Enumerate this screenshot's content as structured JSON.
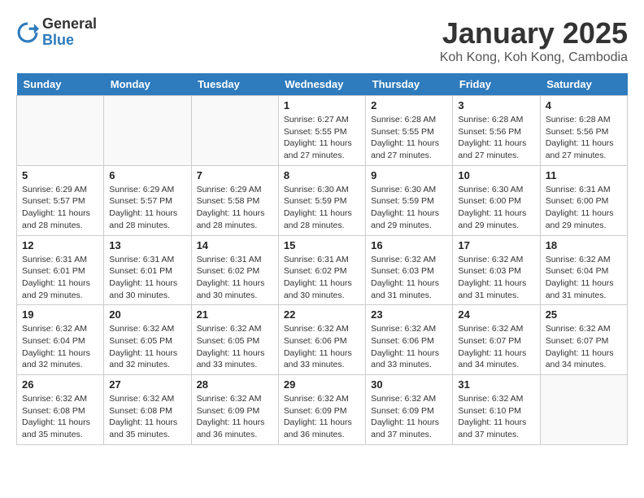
{
  "header": {
    "logo_general": "General",
    "logo_blue": "Blue",
    "title": "January 2025",
    "location": "Koh Kong, Koh Kong, Cambodia"
  },
  "weekdays": [
    "Sunday",
    "Monday",
    "Tuesday",
    "Wednesday",
    "Thursday",
    "Friday",
    "Saturday"
  ],
  "weeks": [
    [
      {
        "day": "",
        "info": ""
      },
      {
        "day": "",
        "info": ""
      },
      {
        "day": "",
        "info": ""
      },
      {
        "day": "1",
        "info": "Sunrise: 6:27 AM\nSunset: 5:55 PM\nDaylight: 11 hours and 27 minutes."
      },
      {
        "day": "2",
        "info": "Sunrise: 6:28 AM\nSunset: 5:55 PM\nDaylight: 11 hours and 27 minutes."
      },
      {
        "day": "3",
        "info": "Sunrise: 6:28 AM\nSunset: 5:56 PM\nDaylight: 11 hours and 27 minutes."
      },
      {
        "day": "4",
        "info": "Sunrise: 6:28 AM\nSunset: 5:56 PM\nDaylight: 11 hours and 27 minutes."
      }
    ],
    [
      {
        "day": "5",
        "info": "Sunrise: 6:29 AM\nSunset: 5:57 PM\nDaylight: 11 hours and 28 minutes."
      },
      {
        "day": "6",
        "info": "Sunrise: 6:29 AM\nSunset: 5:57 PM\nDaylight: 11 hours and 28 minutes."
      },
      {
        "day": "7",
        "info": "Sunrise: 6:29 AM\nSunset: 5:58 PM\nDaylight: 11 hours and 28 minutes."
      },
      {
        "day": "8",
        "info": "Sunrise: 6:30 AM\nSunset: 5:59 PM\nDaylight: 11 hours and 28 minutes."
      },
      {
        "day": "9",
        "info": "Sunrise: 6:30 AM\nSunset: 5:59 PM\nDaylight: 11 hours and 29 minutes."
      },
      {
        "day": "10",
        "info": "Sunrise: 6:30 AM\nSunset: 6:00 PM\nDaylight: 11 hours and 29 minutes."
      },
      {
        "day": "11",
        "info": "Sunrise: 6:31 AM\nSunset: 6:00 PM\nDaylight: 11 hours and 29 minutes."
      }
    ],
    [
      {
        "day": "12",
        "info": "Sunrise: 6:31 AM\nSunset: 6:01 PM\nDaylight: 11 hours and 29 minutes."
      },
      {
        "day": "13",
        "info": "Sunrise: 6:31 AM\nSunset: 6:01 PM\nDaylight: 11 hours and 30 minutes."
      },
      {
        "day": "14",
        "info": "Sunrise: 6:31 AM\nSunset: 6:02 PM\nDaylight: 11 hours and 30 minutes."
      },
      {
        "day": "15",
        "info": "Sunrise: 6:31 AM\nSunset: 6:02 PM\nDaylight: 11 hours and 30 minutes."
      },
      {
        "day": "16",
        "info": "Sunrise: 6:32 AM\nSunset: 6:03 PM\nDaylight: 11 hours and 31 minutes."
      },
      {
        "day": "17",
        "info": "Sunrise: 6:32 AM\nSunset: 6:03 PM\nDaylight: 11 hours and 31 minutes."
      },
      {
        "day": "18",
        "info": "Sunrise: 6:32 AM\nSunset: 6:04 PM\nDaylight: 11 hours and 31 minutes."
      }
    ],
    [
      {
        "day": "19",
        "info": "Sunrise: 6:32 AM\nSunset: 6:04 PM\nDaylight: 11 hours and 32 minutes."
      },
      {
        "day": "20",
        "info": "Sunrise: 6:32 AM\nSunset: 6:05 PM\nDaylight: 11 hours and 32 minutes."
      },
      {
        "day": "21",
        "info": "Sunrise: 6:32 AM\nSunset: 6:05 PM\nDaylight: 11 hours and 33 minutes."
      },
      {
        "day": "22",
        "info": "Sunrise: 6:32 AM\nSunset: 6:06 PM\nDaylight: 11 hours and 33 minutes."
      },
      {
        "day": "23",
        "info": "Sunrise: 6:32 AM\nSunset: 6:06 PM\nDaylight: 11 hours and 33 minutes."
      },
      {
        "day": "24",
        "info": "Sunrise: 6:32 AM\nSunset: 6:07 PM\nDaylight: 11 hours and 34 minutes."
      },
      {
        "day": "25",
        "info": "Sunrise: 6:32 AM\nSunset: 6:07 PM\nDaylight: 11 hours and 34 minutes."
      }
    ],
    [
      {
        "day": "26",
        "info": "Sunrise: 6:32 AM\nSunset: 6:08 PM\nDaylight: 11 hours and 35 minutes."
      },
      {
        "day": "27",
        "info": "Sunrise: 6:32 AM\nSunset: 6:08 PM\nDaylight: 11 hours and 35 minutes."
      },
      {
        "day": "28",
        "info": "Sunrise: 6:32 AM\nSunset: 6:09 PM\nDaylight: 11 hours and 36 minutes."
      },
      {
        "day": "29",
        "info": "Sunrise: 6:32 AM\nSunset: 6:09 PM\nDaylight: 11 hours and 36 minutes."
      },
      {
        "day": "30",
        "info": "Sunrise: 6:32 AM\nSunset: 6:09 PM\nDaylight: 11 hours and 37 minutes."
      },
      {
        "day": "31",
        "info": "Sunrise: 6:32 AM\nSunset: 6:10 PM\nDaylight: 11 hours and 37 minutes."
      },
      {
        "day": "",
        "info": ""
      }
    ]
  ]
}
